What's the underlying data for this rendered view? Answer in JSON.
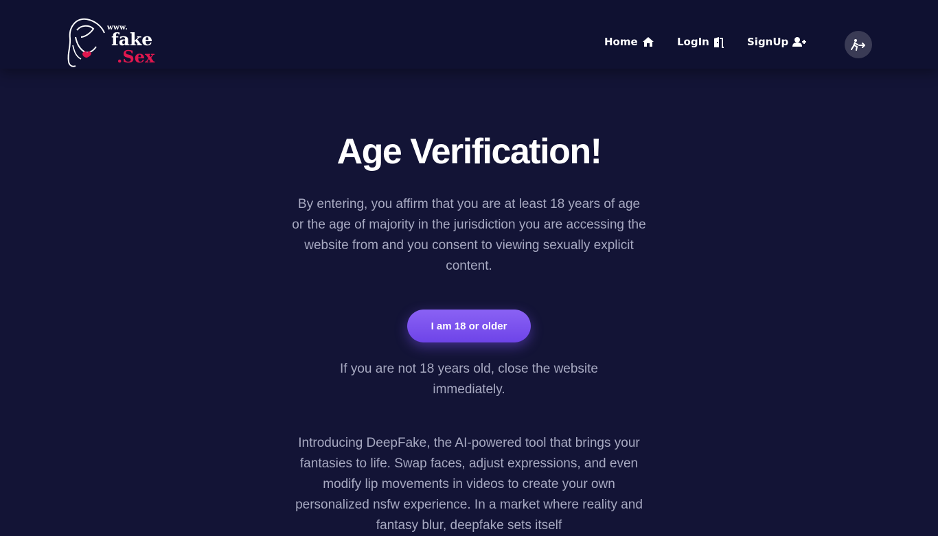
{
  "logo": {
    "www": "www.",
    "name": "fake",
    "tld": ".Sex"
  },
  "nav": {
    "home": {
      "label": "Home",
      "icon": "home-icon"
    },
    "login": {
      "label": "LogIn",
      "icon": "door-icon"
    },
    "signup": {
      "label": "SignUp",
      "icon": "user-plus-icon"
    },
    "exit": {
      "icon": "exit-walk-icon"
    }
  },
  "main": {
    "title": "Age Verification!",
    "affirmation": "By entering, you affirm that you are at least 18 years of age or the age of majority in the jurisdiction you are accessing the website from and you consent to viewing sexually explicit content.",
    "confirm_button": "I am 18 or older",
    "notice": "If you are not 18 years old, close the website immediately.",
    "intro": "Introducing DeepFake, the AI-powered tool that brings your fantasies to life. Swap faces, adjust expressions, and even modify lip movements in videos to create your own personalized nsfw experience. In a market where reality and fantasy blur, deepfake sets itself"
  },
  "colors": {
    "background": "#131436",
    "header": "#0f1131",
    "accent": "#7b52f0",
    "brand_red": "#e0174e",
    "muted_text": "#a7a9c1"
  }
}
